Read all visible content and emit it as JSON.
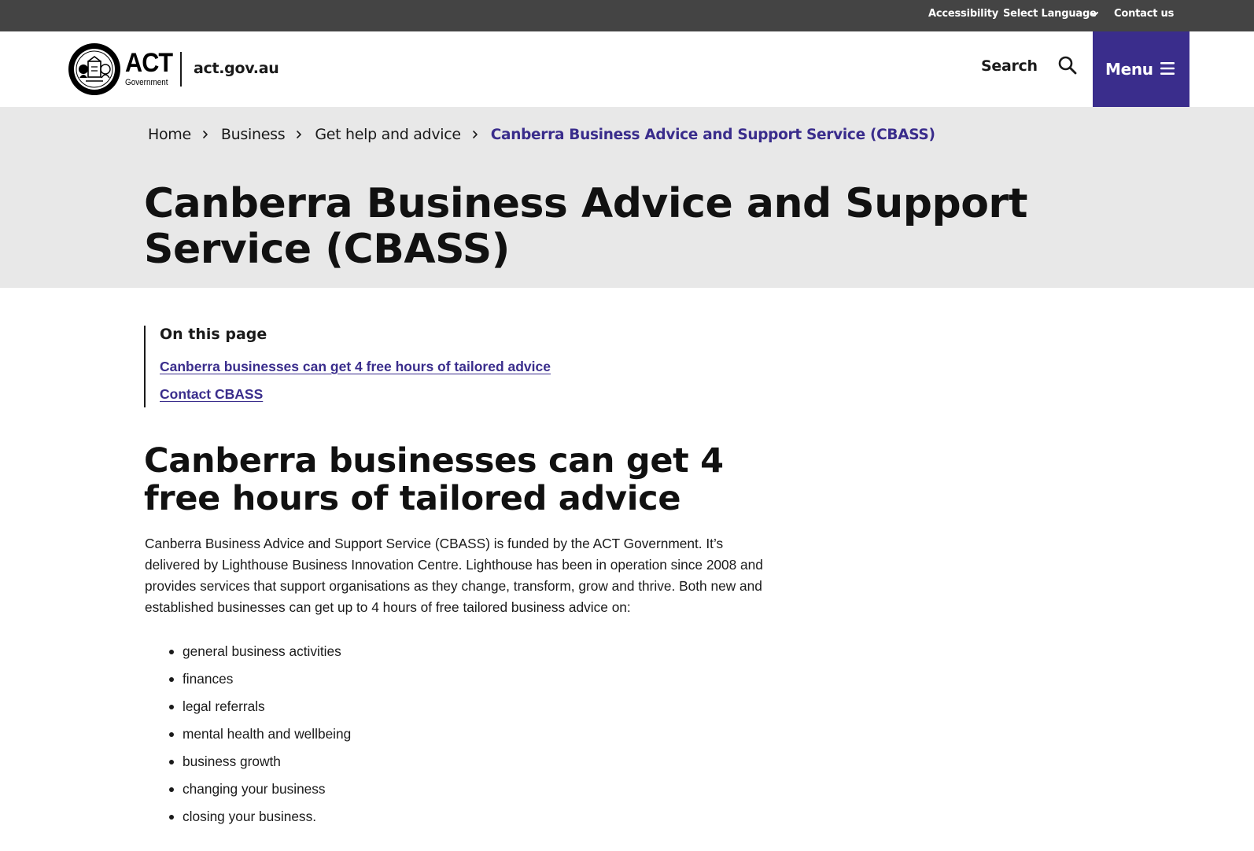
{
  "utility_bar": {
    "accessibility": "Accessibility",
    "select_language": "Select Language",
    "contact_us": "Contact us"
  },
  "header": {
    "logo_text": "ACT",
    "logo_subtext": "Government",
    "site_domain": "act.gov.au",
    "search_label": "Search",
    "menu_label": "Menu"
  },
  "breadcrumb": {
    "items": [
      "Home",
      "Business",
      "Get help and advice"
    ],
    "current": "Canberra Business Advice and Support Service (CBASS)"
  },
  "page_title": "Canberra Business Advice and Support Service (CBASS)",
  "on_this_page": {
    "heading": "On this page",
    "links": [
      "Canberra businesses can get 4 free hours of tailored advice",
      "Contact CBASS"
    ]
  },
  "content": {
    "section_heading": "Canberra businesses can get 4 free hours of tailored advice",
    "intro": "Canberra Business Advice and Support Service (CBASS) is funded by the ACT Government. It’s delivered by Lighthouse Business Innovation Centre. Lighthouse has been in operation since 2008 and provides services that support organisations as they change, transform, grow and thrive. Both new and established businesses can get up to 4 hours of free tailored business advice on:",
    "topics": [
      "general business activities",
      "finances",
      "legal referrals",
      "mental health and wellbeing",
      "business growth",
      "changing your business",
      "closing your business."
    ]
  },
  "colors": {
    "utility_bar_bg": "#444444",
    "accent_purple": "#3a2d8c",
    "hero_bg": "#e8e8e8",
    "text": "#1a1a1a"
  },
  "icons": [
    "chevron-down-icon",
    "search-icon",
    "menu-icon",
    "chevron-right-icon",
    "act-seal-icon"
  ]
}
